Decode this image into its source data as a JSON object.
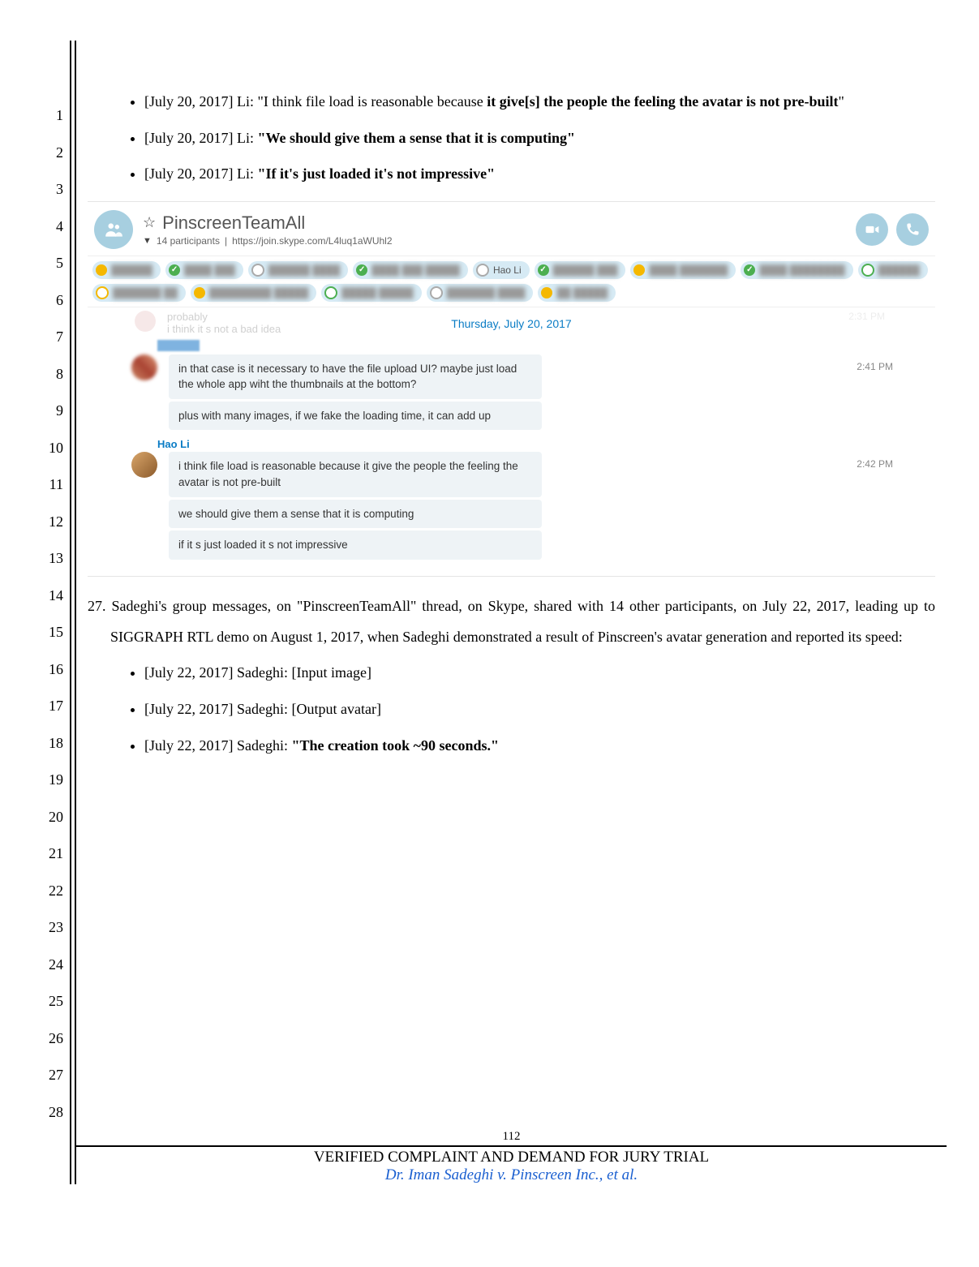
{
  "lineNumbers": [
    "1",
    "2",
    "3",
    "4",
    "5",
    "6",
    "7",
    "8",
    "9",
    "10",
    "11",
    "12",
    "13",
    "14",
    "15",
    "16",
    "17",
    "18",
    "19",
    "20",
    "21",
    "22",
    "23",
    "24",
    "25",
    "26",
    "27",
    "28"
  ],
  "bulletsTop": [
    {
      "prefix": "[July 20, 2017] Li: \"I think file load is reasonable because ",
      "bold": "it give[s] the people the feeling the avatar is not pre-built",
      "suffix": "\""
    },
    {
      "prefix": "[July 20, 2017] Li: ",
      "bold": "\"We should give them a sense that it is computing\"",
      "suffix": ""
    },
    {
      "prefix": "[July 20, 2017] Li: ",
      "bold": "\"If it's just loaded it's not impressive\"",
      "suffix": ""
    }
  ],
  "skype": {
    "title": "PinscreenTeamAll",
    "subParticipants": "14 participants",
    "subLink": "https://join.skype.com/L4luq1aWUhl2",
    "pillsRow1": [
      {
        "dot": "yellow",
        "name": "██████"
      },
      {
        "dot": "green",
        "name": "████ ███"
      },
      {
        "dot": "outline-gray",
        "name": "██████ ████"
      },
      {
        "dot": "green",
        "name": "████ ███ █████"
      },
      {
        "dot": "outline-gray",
        "name": "Hao Li"
      },
      {
        "dot": "green",
        "name": "██████ ███"
      },
      {
        "dot": "yellow",
        "name": "████ ███████"
      }
    ],
    "pillsRow2": [
      {
        "dot": "green",
        "name": "████ ████████"
      },
      {
        "dot": "outline-green",
        "name": "██████"
      },
      {
        "dot": "outline-yellow",
        "name": "███████ ██"
      },
      {
        "dot": "yellow",
        "name": "█████████ █████"
      },
      {
        "dot": "outline-green",
        "name": "█████ █████"
      },
      {
        "dot": "outline-gray",
        "name": "███████ ████"
      },
      {
        "dot": "yellow",
        "name": "██ █████"
      }
    ],
    "fadedLines": [
      "probably",
      "i think it s not a bad idea"
    ],
    "fadedTime": "2:31 PM",
    "dateDivider": "Thursday, July 20, 2017",
    "msg1": {
      "lines": [
        "in that case is it necessary to have the file upload UI? maybe just load the whole app wiht the thumbnails at the bottom?",
        "plus with many images, if we fake the loading time, it can add up"
      ],
      "time": "2:41 PM"
    },
    "msg2": {
      "name": "Hao Li",
      "lines": [
        "i think file load is reasonable because it give the people the feeling the avatar is not pre-built",
        "we should give them a sense that it is computing",
        "if it s just loaded it s not impressive"
      ],
      "time": "2:42 PM"
    }
  },
  "para27": {
    "num": "27.",
    "text": "Sadeghi's group messages, on \"PinscreenTeamAll\" thread, on Skype, shared with 14 other participants, on July 22, 2017, leading up to SIGGRAPH RTL demo on August 1, 2017, when Sadeghi demonstrated a result of Pinscreen's avatar generation and reported its speed:"
  },
  "bulletsBottom": [
    {
      "prefix": "[July 22, 2017] Sadeghi: [Input image]",
      "bold": "",
      "suffix": ""
    },
    {
      "prefix": "[July 22, 2017] Sadeghi: [Output avatar]",
      "bold": "",
      "suffix": ""
    },
    {
      "prefix": "[July 22, 2017] Sadeghi: ",
      "bold": "\"The creation took ~90 seconds.\"",
      "suffix": ""
    }
  ],
  "footer": {
    "pageNum": "112",
    "title": "VERIFIED COMPLAINT AND DEMAND FOR JURY TRIAL",
    "case": "Dr. Iman Sadeghi v. Pinscreen Inc., et al."
  }
}
